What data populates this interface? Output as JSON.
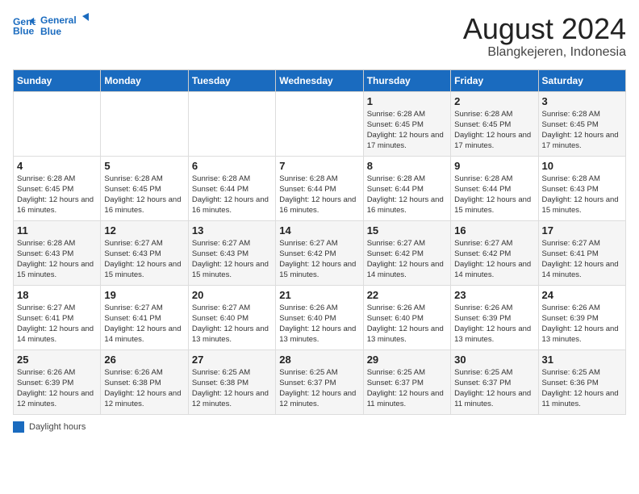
{
  "header": {
    "logo_line1": "General",
    "logo_line2": "Blue",
    "title": "August 2024",
    "subtitle": "Blangkejeren, Indonesia"
  },
  "days_of_week": [
    "Sunday",
    "Monday",
    "Tuesday",
    "Wednesday",
    "Thursday",
    "Friday",
    "Saturday"
  ],
  "weeks": [
    [
      {
        "day": "",
        "info": ""
      },
      {
        "day": "",
        "info": ""
      },
      {
        "day": "",
        "info": ""
      },
      {
        "day": "",
        "info": ""
      },
      {
        "day": "1",
        "info": "Sunrise: 6:28 AM\nSunset: 6:45 PM\nDaylight: 12 hours\nand 17 minutes."
      },
      {
        "day": "2",
        "info": "Sunrise: 6:28 AM\nSunset: 6:45 PM\nDaylight: 12 hours\nand 17 minutes."
      },
      {
        "day": "3",
        "info": "Sunrise: 6:28 AM\nSunset: 6:45 PM\nDaylight: 12 hours\nand 17 minutes."
      }
    ],
    [
      {
        "day": "4",
        "info": "Sunrise: 6:28 AM\nSunset: 6:45 PM\nDaylight: 12 hours\nand 16 minutes."
      },
      {
        "day": "5",
        "info": "Sunrise: 6:28 AM\nSunset: 6:45 PM\nDaylight: 12 hours\nand 16 minutes."
      },
      {
        "day": "6",
        "info": "Sunrise: 6:28 AM\nSunset: 6:44 PM\nDaylight: 12 hours\nand 16 minutes."
      },
      {
        "day": "7",
        "info": "Sunrise: 6:28 AM\nSunset: 6:44 PM\nDaylight: 12 hours\nand 16 minutes."
      },
      {
        "day": "8",
        "info": "Sunrise: 6:28 AM\nSunset: 6:44 PM\nDaylight: 12 hours\nand 16 minutes."
      },
      {
        "day": "9",
        "info": "Sunrise: 6:28 AM\nSunset: 6:44 PM\nDaylight: 12 hours\nand 15 minutes."
      },
      {
        "day": "10",
        "info": "Sunrise: 6:28 AM\nSunset: 6:43 PM\nDaylight: 12 hours\nand 15 minutes."
      }
    ],
    [
      {
        "day": "11",
        "info": "Sunrise: 6:28 AM\nSunset: 6:43 PM\nDaylight: 12 hours\nand 15 minutes."
      },
      {
        "day": "12",
        "info": "Sunrise: 6:27 AM\nSunset: 6:43 PM\nDaylight: 12 hours\nand 15 minutes."
      },
      {
        "day": "13",
        "info": "Sunrise: 6:27 AM\nSunset: 6:43 PM\nDaylight: 12 hours\nand 15 minutes."
      },
      {
        "day": "14",
        "info": "Sunrise: 6:27 AM\nSunset: 6:42 PM\nDaylight: 12 hours\nand 15 minutes."
      },
      {
        "day": "15",
        "info": "Sunrise: 6:27 AM\nSunset: 6:42 PM\nDaylight: 12 hours\nand 14 minutes."
      },
      {
        "day": "16",
        "info": "Sunrise: 6:27 AM\nSunset: 6:42 PM\nDaylight: 12 hours\nand 14 minutes."
      },
      {
        "day": "17",
        "info": "Sunrise: 6:27 AM\nSunset: 6:41 PM\nDaylight: 12 hours\nand 14 minutes."
      }
    ],
    [
      {
        "day": "18",
        "info": "Sunrise: 6:27 AM\nSunset: 6:41 PM\nDaylight: 12 hours\nand 14 minutes."
      },
      {
        "day": "19",
        "info": "Sunrise: 6:27 AM\nSunset: 6:41 PM\nDaylight: 12 hours\nand 14 minutes."
      },
      {
        "day": "20",
        "info": "Sunrise: 6:27 AM\nSunset: 6:40 PM\nDaylight: 12 hours\nand 13 minutes."
      },
      {
        "day": "21",
        "info": "Sunrise: 6:26 AM\nSunset: 6:40 PM\nDaylight: 12 hours\nand 13 minutes."
      },
      {
        "day": "22",
        "info": "Sunrise: 6:26 AM\nSunset: 6:40 PM\nDaylight: 12 hours\nand 13 minutes."
      },
      {
        "day": "23",
        "info": "Sunrise: 6:26 AM\nSunset: 6:39 PM\nDaylight: 12 hours\nand 13 minutes."
      },
      {
        "day": "24",
        "info": "Sunrise: 6:26 AM\nSunset: 6:39 PM\nDaylight: 12 hours\nand 13 minutes."
      }
    ],
    [
      {
        "day": "25",
        "info": "Sunrise: 6:26 AM\nSunset: 6:39 PM\nDaylight: 12 hours\nand 12 minutes."
      },
      {
        "day": "26",
        "info": "Sunrise: 6:26 AM\nSunset: 6:38 PM\nDaylight: 12 hours\nand 12 minutes."
      },
      {
        "day": "27",
        "info": "Sunrise: 6:25 AM\nSunset: 6:38 PM\nDaylight: 12 hours\nand 12 minutes."
      },
      {
        "day": "28",
        "info": "Sunrise: 6:25 AM\nSunset: 6:37 PM\nDaylight: 12 hours\nand 12 minutes."
      },
      {
        "day": "29",
        "info": "Sunrise: 6:25 AM\nSunset: 6:37 PM\nDaylight: 12 hours\nand 11 minutes."
      },
      {
        "day": "30",
        "info": "Sunrise: 6:25 AM\nSunset: 6:37 PM\nDaylight: 12 hours\nand 11 minutes."
      },
      {
        "day": "31",
        "info": "Sunrise: 6:25 AM\nSunset: 6:36 PM\nDaylight: 12 hours\nand 11 minutes."
      }
    ]
  ],
  "footer": {
    "legend_label": "Daylight hours"
  }
}
